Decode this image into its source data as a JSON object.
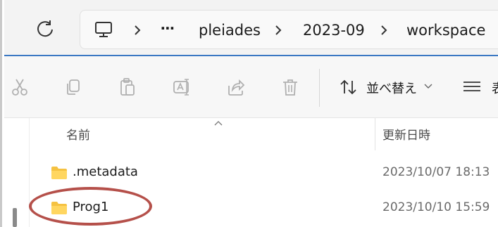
{
  "address_bar": {
    "refresh_icon": "refresh-icon",
    "device_icon": "this-pc-icon",
    "overflow": "⋯",
    "crumbs": [
      "pleiades",
      "2023-09",
      "workspace"
    ]
  },
  "toolbar": {
    "icons": [
      "cut-icon",
      "copy-icon",
      "paste-icon",
      "rename-icon",
      "share-icon",
      "delete-icon"
    ],
    "sort_label": "並べ替え",
    "view_label": "表"
  },
  "file_list": {
    "columns": {
      "name": "名前",
      "modified": "更新日時"
    },
    "rows": [
      {
        "name": ".metadata",
        "modified": "2023/10/07 18:13"
      },
      {
        "name": "Prog1",
        "modified": "2023/10/10 15:59"
      }
    ]
  },
  "colors": {
    "accent": "#3b78c3",
    "highlight": "#b5504a",
    "folder": "#f5c242"
  }
}
